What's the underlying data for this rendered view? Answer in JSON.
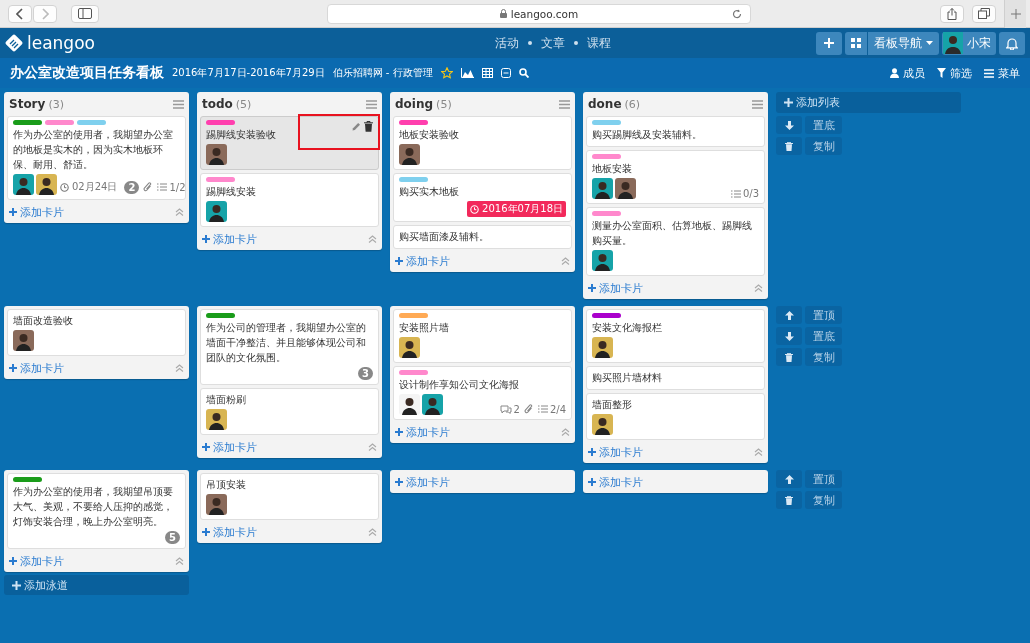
{
  "browser": {
    "url": "leangoo.com"
  },
  "nav": {
    "brand": "leangoo",
    "links": [
      "活动",
      "文章",
      "课程"
    ],
    "board_nav": "看板导航",
    "user": {
      "name": "小宋",
      "avatar": {
        "color": "#16a3a8"
      }
    }
  },
  "board": {
    "title": "办公室改造项目任务看板",
    "dates": "2016年7月17日-2016年7月29日",
    "team": "伯乐招聘网 - 行政管理",
    "right_menu": [
      {
        "kind": "members",
        "label": "成员"
      },
      {
        "kind": "filter",
        "label": "筛选"
      },
      {
        "kind": "menu",
        "label": "菜单"
      }
    ]
  },
  "columns": [
    {
      "name": "Story",
      "count": "(3)"
    },
    {
      "name": "todo",
      "count": "(5)"
    },
    {
      "name": "doing",
      "count": "(5)"
    },
    {
      "name": "done",
      "count": "(6)"
    }
  ],
  "lanes": [
    {
      "add_list": "添加列表",
      "actions": [
        {
          "kind": "down",
          "label": "置底"
        },
        {
          "kind": "copy",
          "label": "复制"
        }
      ],
      "lists": [
        {
          "add_label": "添加卡片",
          "collapse_icon": true,
          "cards": [
            {
              "labels": [
                {
                  "color": "#1a9c1a"
                },
                {
                  "color": "#ff88cc"
                },
                {
                  "color": "#7fd0ee"
                }
              ],
              "title": "作为办公室的使用者，我期望办公室的地板是实木的，因为实木地板环保、耐用、舒适。",
              "avatars": [
                {
                  "color": "#16a3a8"
                },
                {
                  "color": "#d8b552"
                }
              ],
              "due": {
                "text": "02月24日",
                "overdue": false
              },
              "badge": "2",
              "attachment": true,
              "checklist": "1/2"
            }
          ]
        },
        {
          "add_label": "添加卡片",
          "collapse_icon": true,
          "cards": [
            {
              "labels": [
                {
                  "color": "#ff3fae"
                }
              ],
              "title": "踢脚线安装验收",
              "avatars": [
                {
                  "color": "#8a6a5a"
                }
              ],
              "hovered": true
            },
            {
              "labels": [
                {
                  "color": "#ff88cc"
                }
              ],
              "title": "踢脚线安装",
              "avatars": [
                {
                  "color": "#16a3a8"
                }
              ]
            }
          ]
        },
        {
          "add_label": "添加卡片",
          "collapse_icon": true,
          "cards": [
            {
              "labels": [
                {
                  "color": "#ff3fae"
                }
              ],
              "title": "地板安装验收",
              "avatars": [
                {
                  "color": "#8a6a5a"
                }
              ]
            },
            {
              "labels": [
                {
                  "color": "#7fd0ee"
                }
              ],
              "title": "购买实木地板",
              "due": {
                "text": "2016年07月18日",
                "overdue": true
              }
            },
            {
              "title": "购买墙面漆及辅料。"
            }
          ]
        },
        {
          "add_label": "添加卡片",
          "collapse_icon": true,
          "cards": [
            {
              "labels": [
                {
                  "color": "#7fd0ee"
                }
              ],
              "title": "购买踢脚线及安装辅料。"
            },
            {
              "labels": [
                {
                  "color": "#ff88cc"
                }
              ],
              "title": "地板安装",
              "avatars": [
                {
                  "color": "#16a3a8"
                },
                {
                  "color": "#8a6a5a"
                }
              ],
              "checklist": "0/3"
            },
            {
              "labels": [
                {
                  "color": "#ff88cc"
                }
              ],
              "title": "测量办公室面积、估算地板、踢脚线购买量。",
              "avatars": [
                {
                  "color": "#16a3a8"
                }
              ]
            }
          ]
        }
      ]
    },
    {
      "actions": [
        {
          "kind": "up",
          "label": "置顶"
        },
        {
          "kind": "down",
          "label": "置底"
        },
        {
          "kind": "copy",
          "label": "复制"
        }
      ],
      "lists": [
        {
          "add_label": "添加卡片",
          "collapse_icon": true,
          "cards": [
            {
              "title": "墙面改造验收",
              "avatars": [
                {
                  "color": "#8a6a5a"
                }
              ]
            }
          ]
        },
        {
          "add_label": "添加卡片",
          "collapse_icon": true,
          "cards": [
            {
              "labels": [
                {
                  "color": "#1a9c1a"
                }
              ],
              "title": "作为公司的管理者，我期望办公室的墙面干净整洁、并且能够体现公司和团队的文化氛围。",
              "badge": "3"
            },
            {
              "title": "墙面粉刷",
              "avatars": [
                {
                  "color": "#d8b552"
                }
              ]
            }
          ]
        },
        {
          "add_label": "添加卡片",
          "collapse_icon": true,
          "cards": [
            {
              "labels": [
                {
                  "color": "#ffaa55"
                }
              ],
              "title": "安装照片墙",
              "avatars": [
                {
                  "color": "#d8b552"
                }
              ]
            },
            {
              "labels": [
                {
                  "color": "#ff88cc"
                }
              ],
              "title": "设计制作享知公司文化海报",
              "avatars": [
                {
                  "color": "#f4f4f4"
                },
                {
                  "color": "#16a3a8"
                }
              ],
              "comments": "2",
              "attachment": true,
              "checklist": "2/4"
            }
          ]
        },
        {
          "add_label": "添加卡片",
          "collapse_icon": true,
          "cards": [
            {
              "labels": [
                {
                  "color": "#aa00cc"
                }
              ],
              "title": "安装文化海报栏",
              "avatars": [
                {
                  "color": "#d8b552"
                }
              ]
            },
            {
              "title": "购买照片墙材料"
            },
            {
              "title": "墙面整形",
              "avatars": [
                {
                  "color": "#d8b552"
                }
              ]
            }
          ]
        }
      ]
    },
    {
      "actions": [
        {
          "kind": "up",
          "label": "置顶"
        },
        {
          "kind": "copy",
          "label": "复制"
        }
      ],
      "lists": [
        {
          "add_label": "添加卡片",
          "collapse_icon": true,
          "cards": [
            {
              "labels": [
                {
                  "color": "#1a9c1a"
                }
              ],
              "title": "作为办公室的使用者，我期望吊顶要大气、美观，不要给人压抑的感觉，灯饰安装合理，晚上办公室明亮。",
              "badge": "5"
            }
          ]
        },
        {
          "add_label": "添加卡片",
          "collapse_icon": true,
          "cards": [
            {
              "title": "吊顶安装",
              "avatars": [
                {
                  "color": "#8a6a5a"
                }
              ]
            }
          ]
        },
        {
          "add_label": "添加卡片",
          "collapse_icon": false
        },
        {
          "add_label": "添加卡片",
          "collapse_icon": false
        }
      ]
    }
  ],
  "add_lane": "添加泳道"
}
